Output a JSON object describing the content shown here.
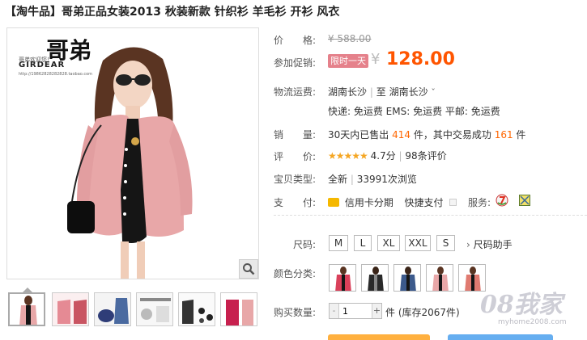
{
  "title": "【淘牛品】哥弟正品女装2013 秋装新款 针织衫 羊毛衫 开衫 风衣",
  "brand_logo": {
    "big_text": "哥弟",
    "small_text": "哥弟欢迎您！",
    "name": "GIRDEAR",
    "url": "http://19862828282828.taobao.com"
  },
  "price": {
    "label": "价　　格:",
    "original": "¥ 588.00"
  },
  "promo": {
    "label": "参加促销:",
    "badge": "限时一天",
    "currency": "¥",
    "price": "128.00"
  },
  "shipping": {
    "label": "物流运费:",
    "from": "湖南长沙",
    "sep": "|",
    "to_prefix": "至",
    "to": "湖南长沙",
    "chevron": "ˇ",
    "fees": "快递: 免运费  EMS: 免运费  平邮: 免运费"
  },
  "sales": {
    "label": "销　　量:",
    "prefix": "30天内已售出",
    "sold": "414",
    "mid": "件，其中交易成功",
    "success": "161",
    "suffix": "件"
  },
  "rating": {
    "label": "评　　价:",
    "stars": "★★★★★",
    "score": "4.7分",
    "sep": "|",
    "count": "98条评价"
  },
  "type": {
    "label": "宝贝类型:",
    "condition": "全新",
    "sep": "|",
    "views": "33991次浏览"
  },
  "payment": {
    "label": "支　　付:",
    "installment": "信用卡分期",
    "quick": "快捷支付",
    "service_label": "服务:"
  },
  "sizes": {
    "label": "尺码:",
    "options": [
      "M",
      "L",
      "XL",
      "XXL",
      "S"
    ],
    "helper": "尺码助手"
  },
  "colors": {
    "label": "颜色分类:"
  },
  "quantity": {
    "label": "购买数量:",
    "minus": "-",
    "value": "1",
    "plus": "+",
    "stock": "件 (库存2067件)"
  },
  "watermark": {
    "text": "08我家",
    "url": "myhome2008.com"
  },
  "colors_palette": {
    "accent_price": "#ff5500",
    "promo_badge": "#e5818b",
    "buy_button": "#ffb03f",
    "cart_button": "#66aef0"
  }
}
